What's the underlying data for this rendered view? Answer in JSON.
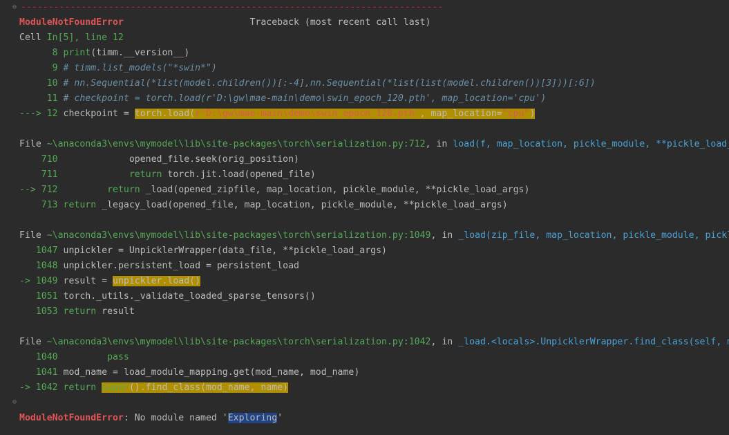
{
  "separator": "-----------------------------------------------------------------------------",
  "header": {
    "error_name": "ModuleNotFoundError",
    "traceback_label": "Traceback (most recent call last)"
  },
  "cell": {
    "prefix": "Cell ",
    "location": "In[5], line 12",
    "lines": [
      {
        "arrow": "      ",
        "num": "8",
        "code_a": "print",
        "code_b": "(timm.__version__)"
      },
      {
        "arrow": "      ",
        "num": "9",
        "comment": "# timm.list_models(\"*swin*\")"
      },
      {
        "arrow": "     ",
        "num": "10",
        "comment": "# nn.Sequential(*list(model.children())[:-4],nn.Sequential(*list(list(model.children())[3]))[:6])"
      },
      {
        "arrow": "     ",
        "num": "11",
        "comment": "# checkpoint = torch.load(r'D:\\gw\\mae-main\\demo\\swin_epoch_120.pth', map_location='cpu')"
      },
      {
        "arrow": "---> ",
        "num": "12",
        "code_pre": "checkpoint = ",
        "hl_a": "torch",
        "hl_b": ".load(",
        "hl_str": "r'D:\\gw\\mae-main\\demo\\swin_epoch_120.pth'",
        "hl_c": ", map_location=",
        "hl_str2": "\"cpu\"",
        "hl_d": ")"
      }
    ]
  },
  "frame1": {
    "file_prefix": "File ",
    "path": "~\\anaconda3\\envs\\mymodel\\lib\\site-packages\\torch\\serialization.py:712",
    "in_text": ", in ",
    "func": "load",
    "args": "(f, map_location, pickle_module, **pickle_load_args)",
    "lines": [
      {
        "arrow": "    ",
        "num": "710",
        "indent": "            ",
        "code": "opened_file.seek(orig_position)"
      },
      {
        "arrow": "    ",
        "num": "711",
        "indent": "            ",
        "kw": "return",
        "code": " torch.jit.load(opened_file)"
      },
      {
        "arrow": "--> ",
        "num": "712",
        "indent": "        ",
        "kw": "return",
        "code": " _load(opened_zipfile, map_location, pickle_module, **pickle_load_args)"
      },
      {
        "arrow": "    ",
        "num": "713",
        "indent": "",
        "kw": "return",
        "code": " _legacy_load(opened_file, map_location, pickle_module, **pickle_load_args)"
      }
    ]
  },
  "frame2": {
    "file_prefix": "File ",
    "path": "~\\anaconda3\\envs\\mymodel\\lib\\site-packages\\torch\\serialization.py:1049",
    "in_text": ", in ",
    "func": "_load",
    "args": "(zip_file, map_location, pickle_module, pickle_file, **pickle_load_args)",
    "lines": [
      {
        "arrow": "   ",
        "num": "1047",
        "code": "unpickler = UnpicklerWrapper(data_file, **pickle_load_args)"
      },
      {
        "arrow": "   ",
        "num": "1048",
        "code": "unpickler.persistent_load = persistent_load"
      },
      {
        "arrow": "-> ",
        "num": "1049",
        "code_pre": "result = ",
        "hl": "unpickler.load()"
      },
      {
        "arrow": "   ",
        "num": "1051",
        "code": "torch._utils._validate_loaded_sparse_tensors()"
      },
      {
        "arrow": "   ",
        "num": "1053",
        "kw": "return",
        "code": " result"
      }
    ]
  },
  "frame3": {
    "file_prefix": "File ",
    "path": "~\\anaconda3\\envs\\mymodel\\lib\\site-packages\\torch\\serialization.py:1042",
    "in_text": ", in ",
    "func": "_load.<locals>.UnpicklerWrapper.find_class",
    "args": "(self, mod_name, name)",
    "lines": [
      {
        "arrow": "   ",
        "num": "1040",
        "indent": "        ",
        "kw": "pass"
      },
      {
        "arrow": "   ",
        "num": "1041",
        "code": "mod_name = load_module_mapping.get(mod_name, mod_name)"
      },
      {
        "arrow": "-> ",
        "num": "1042",
        "kw": "return",
        "hl_kw": "super",
        "hl_rest": "().find_class(mod_name, name)"
      }
    ]
  },
  "footer": {
    "error_name": "ModuleNotFoundError",
    "message_a": ": No module named '",
    "module": "Exploring",
    "message_b": "'"
  }
}
